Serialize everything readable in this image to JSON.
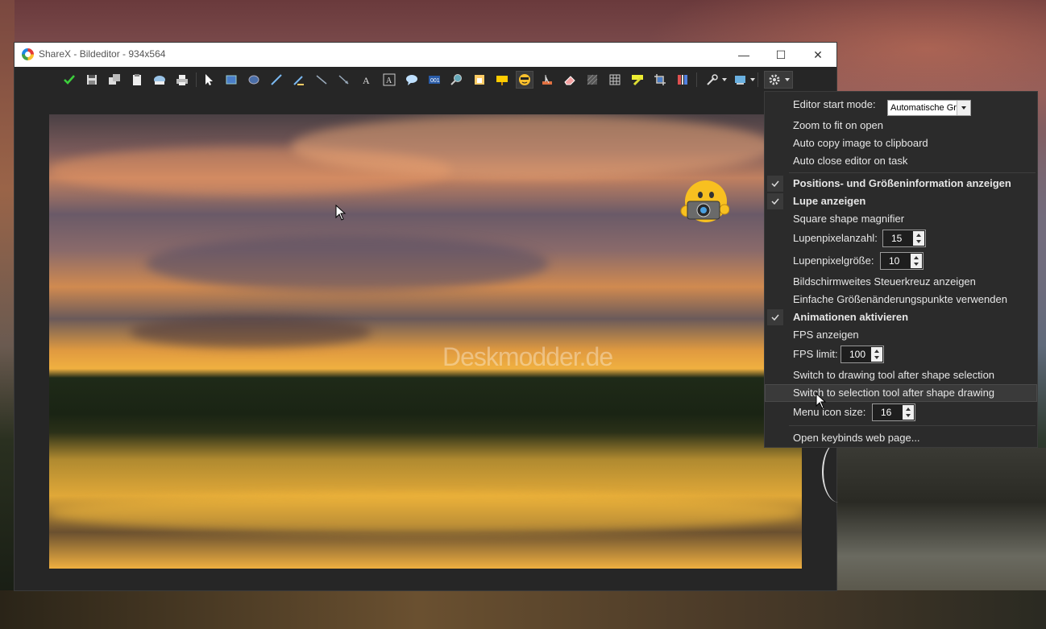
{
  "window": {
    "title": "ShareX - Bildeditor - 934x564",
    "minimize_glyph": "—",
    "maximize_glyph": "☐",
    "close_glyph": "✕"
  },
  "canvas": {
    "watermark": "Deskmodder.de"
  },
  "toolbar": {
    "icons": [
      "checkmark-icon",
      "save-icon",
      "save-as-icon",
      "copy-icon",
      "upload-icon",
      "print-icon",
      "select-icon",
      "rectangle-icon",
      "ellipse-icon",
      "freehand-icon",
      "smart-eraser-icon",
      "line-icon",
      "arrow-icon",
      "text-outline-icon",
      "text-background-icon",
      "speech-balloon-icon",
      "step-icon",
      "magnify-icon",
      "image-icon",
      "sticker-icon",
      "cursor-icon",
      "eraser-icon",
      "blur-icon",
      "pixelate-icon",
      "highlight-icon",
      "crop-icon",
      "cut-out-icon",
      "tools-icon",
      "image-settings-icon",
      "gear-icon"
    ]
  },
  "settings_menu": {
    "editor_start_mode_label": "Editor start mode:",
    "editor_start_mode_value": "Automatische Gr",
    "zoom_to_fit": "Zoom to fit on open",
    "auto_copy": "Auto copy image to clipboard",
    "auto_close": "Auto close editor on task",
    "show_pos_size": "Positions- und Größeninformation anzeigen",
    "show_magnifier": "Lupe anzeigen",
    "square_magnifier": "Square shape magnifier",
    "magnifier_pixel_count_label": "Lupenpixelanzahl:",
    "magnifier_pixel_count_value": "15",
    "magnifier_pixel_size_label": "Lupenpixelgröße:",
    "magnifier_pixel_size_value": "10",
    "screen_crosshair": "Bildschirmweites Steuerkreuz anzeigen",
    "simple_resize": "Einfache Größenänderungspunkte verwenden",
    "animations": "Animationen aktivieren",
    "show_fps": "FPS anzeigen",
    "fps_limit_label": "FPS limit:",
    "fps_limit_value": "100",
    "switch_drawing": "Switch to drawing tool after shape selection",
    "switch_selection": "Switch to selection tool after shape drawing",
    "menu_icon_size_label": "Menu icon size:",
    "menu_icon_size_value": "16",
    "open_keybinds": "Open keybinds web page..."
  }
}
